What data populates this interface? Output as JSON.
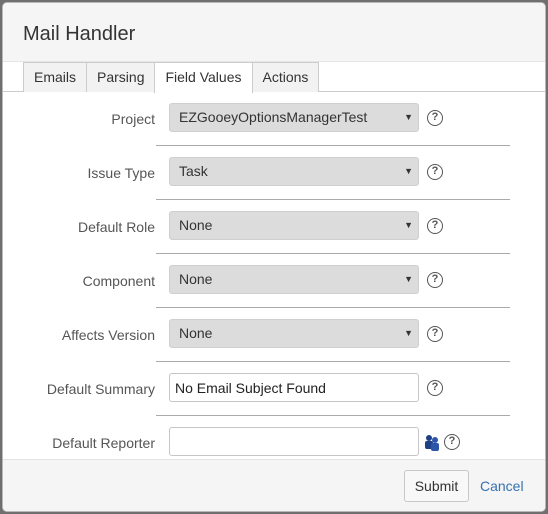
{
  "dialog": {
    "title": "Mail Handler",
    "tabs": [
      {
        "label": "Emails",
        "active": false
      },
      {
        "label": "Parsing",
        "active": false
      },
      {
        "label": "Field Values",
        "active": true
      },
      {
        "label": "Actions",
        "active": false
      }
    ],
    "fields": {
      "project": {
        "label": "Project",
        "value": "EZGooeyOptionsManagerTest"
      },
      "issue_type": {
        "label": "Issue Type",
        "value": "Task"
      },
      "default_role": {
        "label": "Default Role",
        "value": "None"
      },
      "component": {
        "label": "Component",
        "value": "None"
      },
      "affects_version": {
        "label": "Affects Version",
        "value": "None"
      },
      "default_summary": {
        "label": "Default Summary",
        "value": "No Email Subject Found"
      },
      "default_reporter": {
        "label": "Default Reporter",
        "value": ""
      }
    },
    "help_glyph": "?",
    "dropdown_arrow": "▼",
    "footer": {
      "submit_label": "Submit",
      "cancel_label": "Cancel"
    }
  },
  "colors": {
    "accent_link": "#3572b0",
    "select_bg": "#dcdcdc",
    "header_bg": "#f5f5f5"
  },
  "icons": {
    "help": "question-circle-icon",
    "user_picker": "user-picker-icon"
  }
}
